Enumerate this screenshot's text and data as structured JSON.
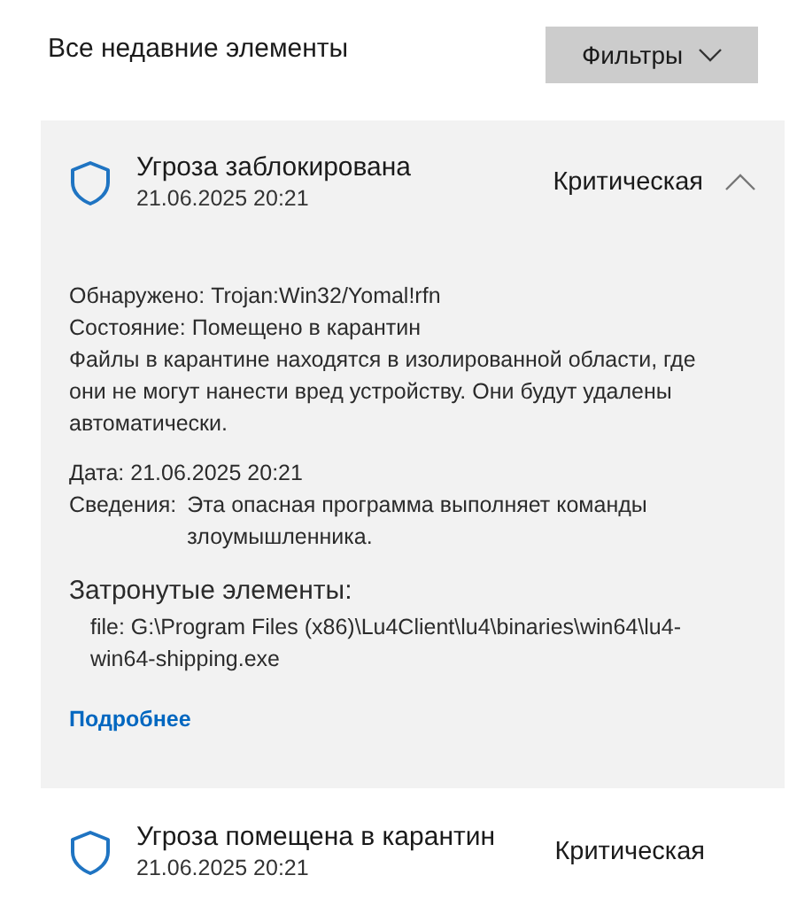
{
  "header": {
    "title": "Все недавние элементы",
    "filter_button": "Фильтры"
  },
  "items": [
    {
      "title": "Угроза заблокирована",
      "date": "21.06.2025 20:21",
      "severity": "Критическая",
      "expanded": true,
      "details": {
        "lines": [
          {
            "label": "Обнаружено:",
            "value": "Trojan:Win32/Yomal!rfn"
          },
          {
            "label": "Состояние:",
            "value": "Помещено в карантин"
          }
        ],
        "description": "Файлы в карантине находятся в изолированной области, где они не могут нанести вред устройству. Они будут удалены автоматически.",
        "date": {
          "label": "Дата:",
          "value": "21.06.2025 20:21"
        },
        "info": {
          "label": "Сведения:",
          "value": "Эта опасная программа выполняет команды злоумышленника."
        },
        "affected_heading": "Затронутые элементы:",
        "affected": [
          "file: G:\\Program Files (x86)\\Lu4Client\\lu4\\binaries\\win64\\lu4-win64-shipping.exe"
        ],
        "link": "Подробнее"
      }
    },
    {
      "title": "Угроза помещена в карантин",
      "date": "21.06.2025 20:21",
      "severity": "Критическая",
      "expanded": false
    }
  ]
}
